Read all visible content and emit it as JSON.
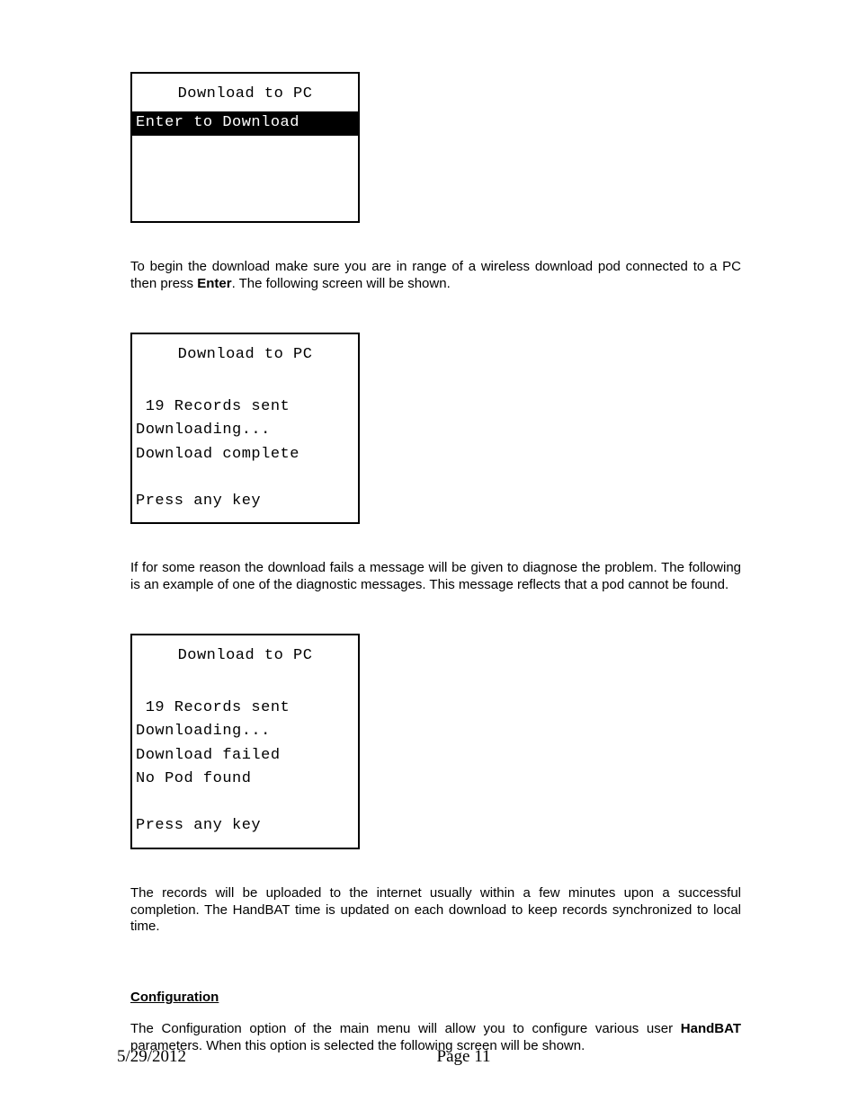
{
  "screen1": {
    "title": "Download to PC",
    "highlight": "Enter to Download"
  },
  "para1": {
    "t1": "To begin the download make sure you are in range of a wireless download pod connected to a PC then press ",
    "bold": "Enter",
    "t2": ".  The following screen will be shown."
  },
  "screen2": {
    "title": "Download to PC",
    "l1": " 19 Records sent",
    "l2": "Downloading...",
    "l3": "Download complete",
    "l4": "Press any key"
  },
  "para2": "If for some reason the download fails a message will be given to diagnose the problem.  The following is an example of one of the diagnostic messages.  This message reflects that a pod cannot be found.",
  "screen3": {
    "title": "Download to PC",
    "l1": " 19 Records sent",
    "l2": "Downloading...",
    "l3": "Download failed",
    "l4": "No Pod found",
    "l5": "Press any key"
  },
  "para3": "The records will be uploaded to the internet usually within a few minutes upon a successful completion.  The HandBAT time is updated on each download to keep records synchronized to local time.",
  "heading": "Configuration",
  "para4": {
    "t1": "The Configuration option of the main menu will allow you to configure various user ",
    "bold": "HandBAT",
    "t2": " parameters.  When this option is selected the following screen will be shown."
  },
  "footer": {
    "date": "5/29/2012",
    "page": "Page   11"
  }
}
